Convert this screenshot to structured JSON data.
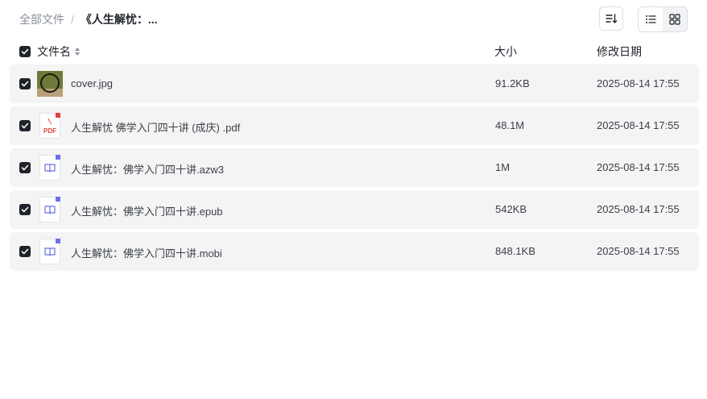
{
  "breadcrumb": {
    "root": "全部文件",
    "separator": "/",
    "current": "《人生解忧：..."
  },
  "columns": {
    "name": "文件名",
    "size": "大小",
    "modified": "修改日期"
  },
  "files": [
    {
      "name": "cover.jpg",
      "size": "91.2KB",
      "modified": "2025-08-14 17:55",
      "type": "image",
      "checked": true
    },
    {
      "name": "人生解忧 佛学入门四十讲 (成庆) .pdf",
      "size": "48.1M",
      "modified": "2025-08-14 17:55",
      "type": "pdf",
      "icon_label": "PDF",
      "checked": true
    },
    {
      "name": "人生解忧：佛学入门四十讲.azw3",
      "size": "1M",
      "modified": "2025-08-14 17:55",
      "type": "ebook",
      "checked": true
    },
    {
      "name": "人生解忧：佛学入门四十讲.epub",
      "size": "542KB",
      "modified": "2025-08-14 17:55",
      "type": "ebook",
      "checked": true
    },
    {
      "name": "人生解忧：佛学入门四十讲.mobi",
      "size": "848.1KB",
      "modified": "2025-08-14 17:55",
      "type": "ebook",
      "checked": true
    }
  ],
  "colors": {
    "pdf": "#e0413d",
    "ebook": "#6a6fe8",
    "checkbox": "#1f2329",
    "row_bg": "#f4f4f5"
  },
  "icons": {
    "sort": "sort-icon",
    "list_view": "list-view-icon",
    "grid_view": "grid-view-icon",
    "sort_toggle": "sort-toggle-icon"
  }
}
